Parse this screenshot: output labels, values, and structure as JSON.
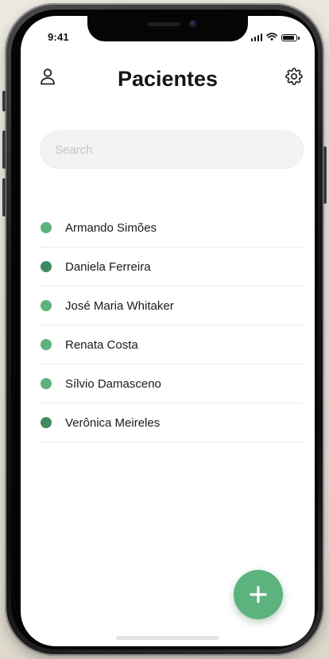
{
  "status_bar": {
    "time": "9:41"
  },
  "header": {
    "title": "Pacientes",
    "left_icon": "user-icon",
    "right_icon": "gear-icon"
  },
  "search": {
    "value": "",
    "placeholder": "Search"
  },
  "patients": [
    {
      "name": "Armando Simões",
      "status_color": "#5db37e"
    },
    {
      "name": "Daniela Ferreira",
      "status_color": "#3f8a5f"
    },
    {
      "name": "José Maria Whitaker",
      "status_color": "#5db37e"
    },
    {
      "name": "Renata Costa",
      "status_color": "#5db37e"
    },
    {
      "name": "Sílvio Damasceno",
      "status_color": "#5db37e"
    },
    {
      "name": "Verônica Meireles",
      "status_color": "#3f8a5f"
    }
  ],
  "fab": {
    "icon": "plus-icon",
    "color": "#5db37e"
  },
  "colors": {
    "accent": "#5db37e",
    "accent_dark": "#3f8a5f",
    "text": "#1a1a1a",
    "divider": "#ececec"
  }
}
